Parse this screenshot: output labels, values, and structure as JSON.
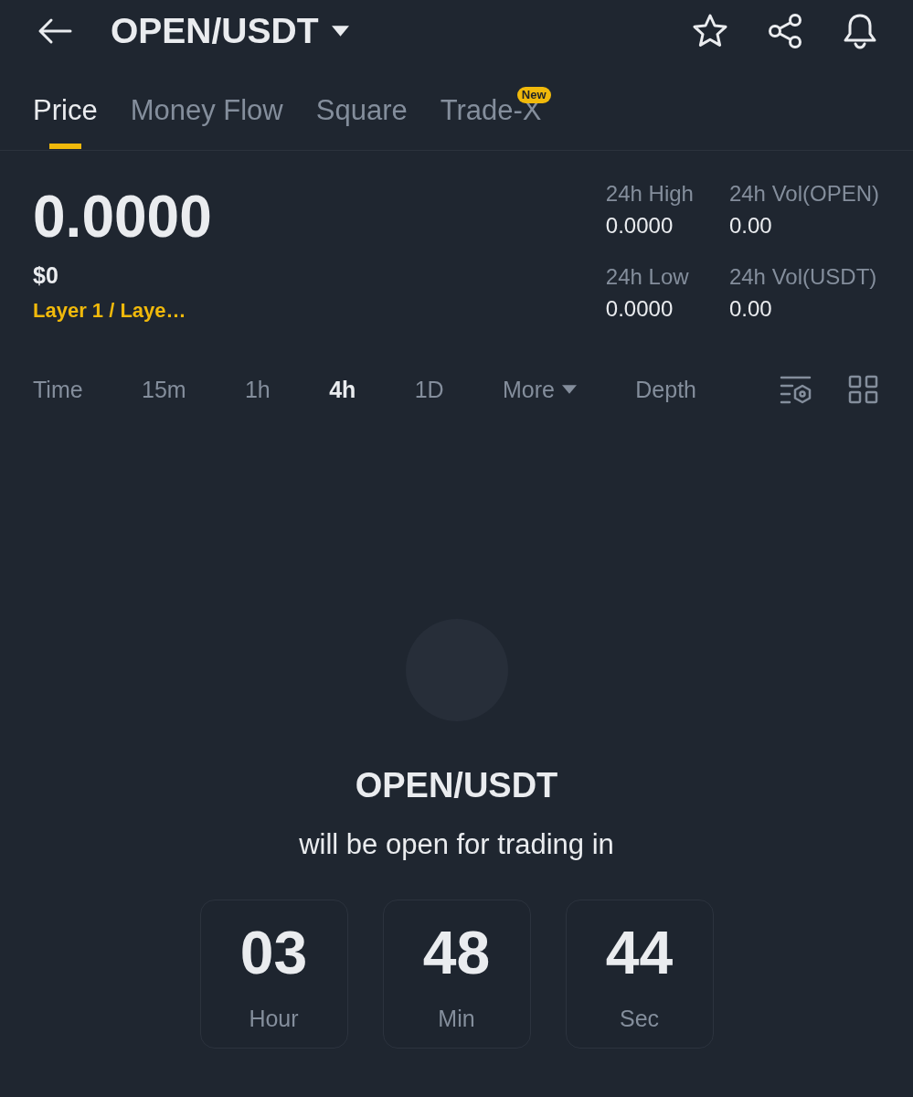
{
  "header": {
    "title": "OPEN/USDT"
  },
  "tabs": [
    {
      "label": "Price",
      "selected": true
    },
    {
      "label": "Money Flow",
      "selected": false
    },
    {
      "label": "Square",
      "selected": false
    },
    {
      "label": "Trade-X",
      "selected": false,
      "badge": "New"
    }
  ],
  "ticker": {
    "price": "0.0000",
    "fiat_price": "$0",
    "category": "Layer 1 / Laye…",
    "stats": [
      {
        "label": "24h High",
        "value": "0.0000"
      },
      {
        "label": "24h Vol(OPEN)",
        "value": "0.00"
      },
      {
        "label": "24h Low",
        "value": "0.0000"
      },
      {
        "label": "24h Vol(USDT)",
        "value": "0.00"
      }
    ]
  },
  "intervals": [
    {
      "label": "Time",
      "kind": "option",
      "selected": false
    },
    {
      "label": "15m",
      "kind": "option",
      "selected": false
    },
    {
      "label": "1h",
      "kind": "option",
      "selected": false
    },
    {
      "label": "4h",
      "kind": "option",
      "selected": true
    },
    {
      "label": "1D",
      "kind": "option",
      "selected": false
    },
    {
      "label": "More",
      "kind": "menu",
      "selected": false
    },
    {
      "label": "Depth",
      "kind": "option",
      "selected": false
    }
  ],
  "countdown": {
    "title": "OPEN/USDT",
    "message": "will be open for trading in",
    "units": [
      {
        "value": "03",
        "label": "Hour"
      },
      {
        "value": "48",
        "label": "Min"
      },
      {
        "value": "44",
        "label": "Sec"
      }
    ]
  }
}
